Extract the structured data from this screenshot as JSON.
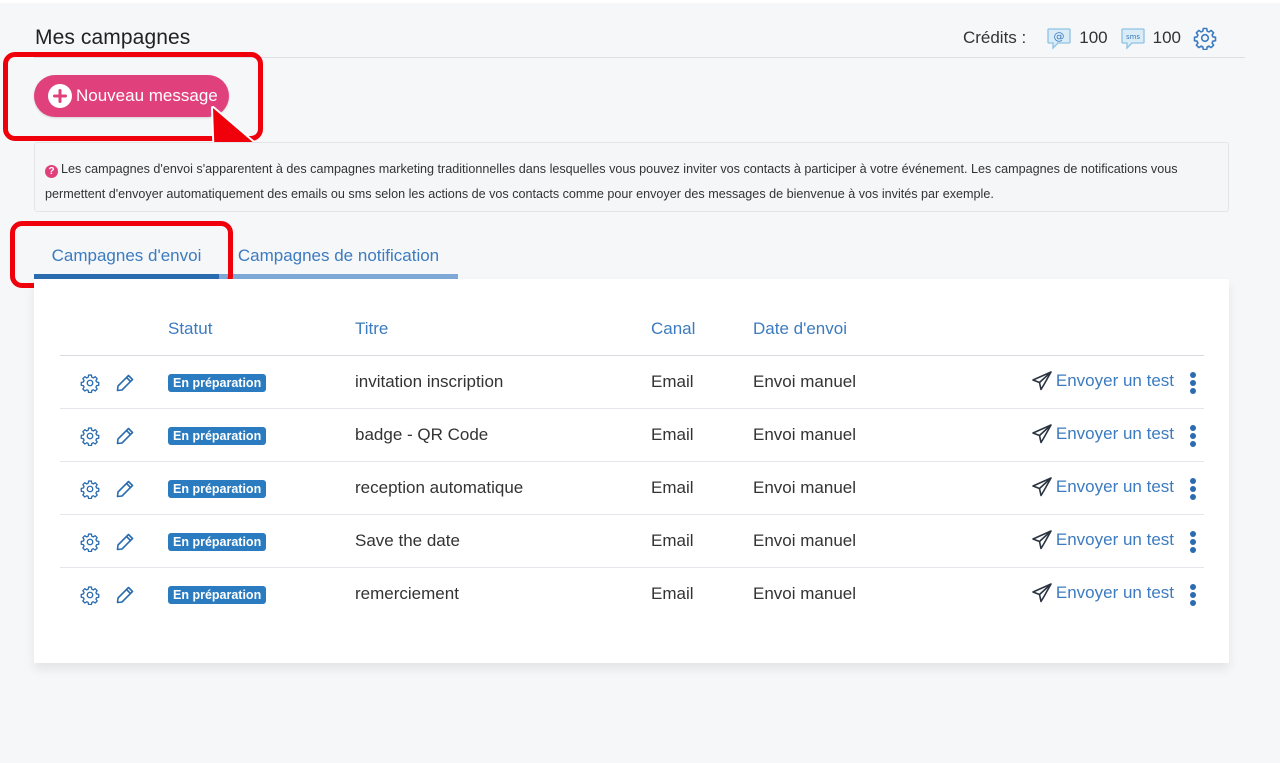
{
  "header": {
    "title": "Mes campagnes",
    "credits_label": "Crédits :",
    "email_credits_icon": "email-credits-icon",
    "email_credits": "100",
    "sms_credits_icon": "sms-credits-icon",
    "sms_credits_icon_text": "sms",
    "sms_credits": "100",
    "settings_icon": "gear-icon"
  },
  "new_message_button": {
    "label": "Nouveau message",
    "icon": "plus-circle-icon"
  },
  "info": {
    "text": "Les campagnes d'envoi s'apparentent à des campagnes marketing traditionnelles dans lesquelles vous pouvez inviter vos contacts à participer à votre événement. Les campagnes de notifications vous permettent d'envoyer automatiquement des emails ou sms selon les actions de vos contacts comme pour envoyer des messages de bienvenue à vos invités par exemple."
  },
  "tabs": [
    {
      "label": "Campagnes d'envoi",
      "active": true
    },
    {
      "label": "Campagnes de notification",
      "active": false
    }
  ],
  "table": {
    "columns": [
      "Statut",
      "Titre",
      "Canal",
      "Date d'envoi"
    ],
    "send_test_label": "Envoyer un test",
    "rows": [
      {
        "status": "En préparation",
        "title": "invitation inscription",
        "channel": "Email",
        "send_date": "Envoi manuel"
      },
      {
        "status": "En préparation",
        "title": "badge - QR Code",
        "channel": "Email",
        "send_date": "Envoi manuel"
      },
      {
        "status": "En préparation",
        "title": "reception automatique",
        "channel": "Email",
        "send_date": "Envoi manuel"
      },
      {
        "status": "En préparation",
        "title": "Save the date",
        "channel": "Email",
        "send_date": "Envoi manuel"
      },
      {
        "status": "En préparation",
        "title": "remerciement",
        "channel": "Email",
        "send_date": "Envoi manuel"
      }
    ]
  },
  "colors": {
    "accent_pink": "#e0417c",
    "link_blue": "#3c7bbf",
    "badge_blue": "#2a7bbf",
    "highlight_red": "#f0000a"
  }
}
